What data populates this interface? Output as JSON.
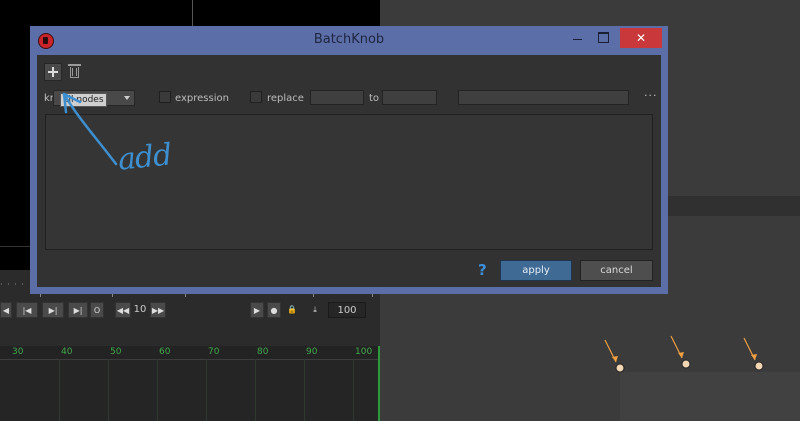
{
  "dialog": {
    "title": "BatchKnob",
    "close_glyph": "✕",
    "toolbar": {
      "add_icon": "plus-icon",
      "delete_icon": "trash-icon"
    },
    "knob_label": "kn",
    "knob_tooltip": "all nodes",
    "expression_label": "expression",
    "replace_label": "replace",
    "to_label": "to",
    "more_label": "···",
    "help_glyph": "?",
    "apply_label": "apply",
    "cancel_label": "cancel",
    "colors": {
      "titlebar": "#5b6ea7",
      "close": "#c9383a",
      "apply": "#3f6a93",
      "help": "#3b8fd9"
    }
  },
  "annotation": {
    "text": "add",
    "color": "#3d8fd0"
  },
  "timeline": {
    "frame_step_value": "10",
    "end_frame_value": "100",
    "frame_labels": [
      "30",
      "40",
      "50",
      "60",
      "70",
      "80",
      "90",
      "100"
    ],
    "colors": {
      "frame_label": "#3fa84a"
    }
  },
  "node_graph": {
    "node_color": "#f3d7b4",
    "arrow_color": "#f0a040"
  }
}
